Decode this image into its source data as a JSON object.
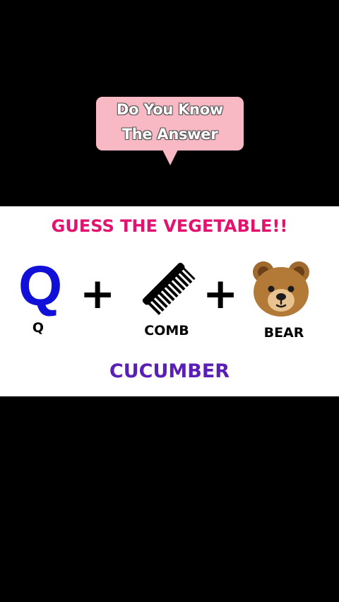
{
  "bubble": {
    "line1": "Do You Know",
    "line2": "The Answer"
  },
  "puzzle": {
    "headline": "GUESS THE VEGETABLE!!",
    "q_letter": "Q",
    "q_label": "Q",
    "plus_symbol": "+",
    "comb_label": "COMB",
    "bear_label": "BEAR",
    "answer": "CUCUMBER"
  },
  "colors": {
    "bubble": "#f8b9c4",
    "headline": "#e3126f",
    "q_letter": "#1010d8",
    "answer": "#5a1fb5"
  },
  "icons": [
    "comb-icon",
    "bear-face-icon"
  ]
}
